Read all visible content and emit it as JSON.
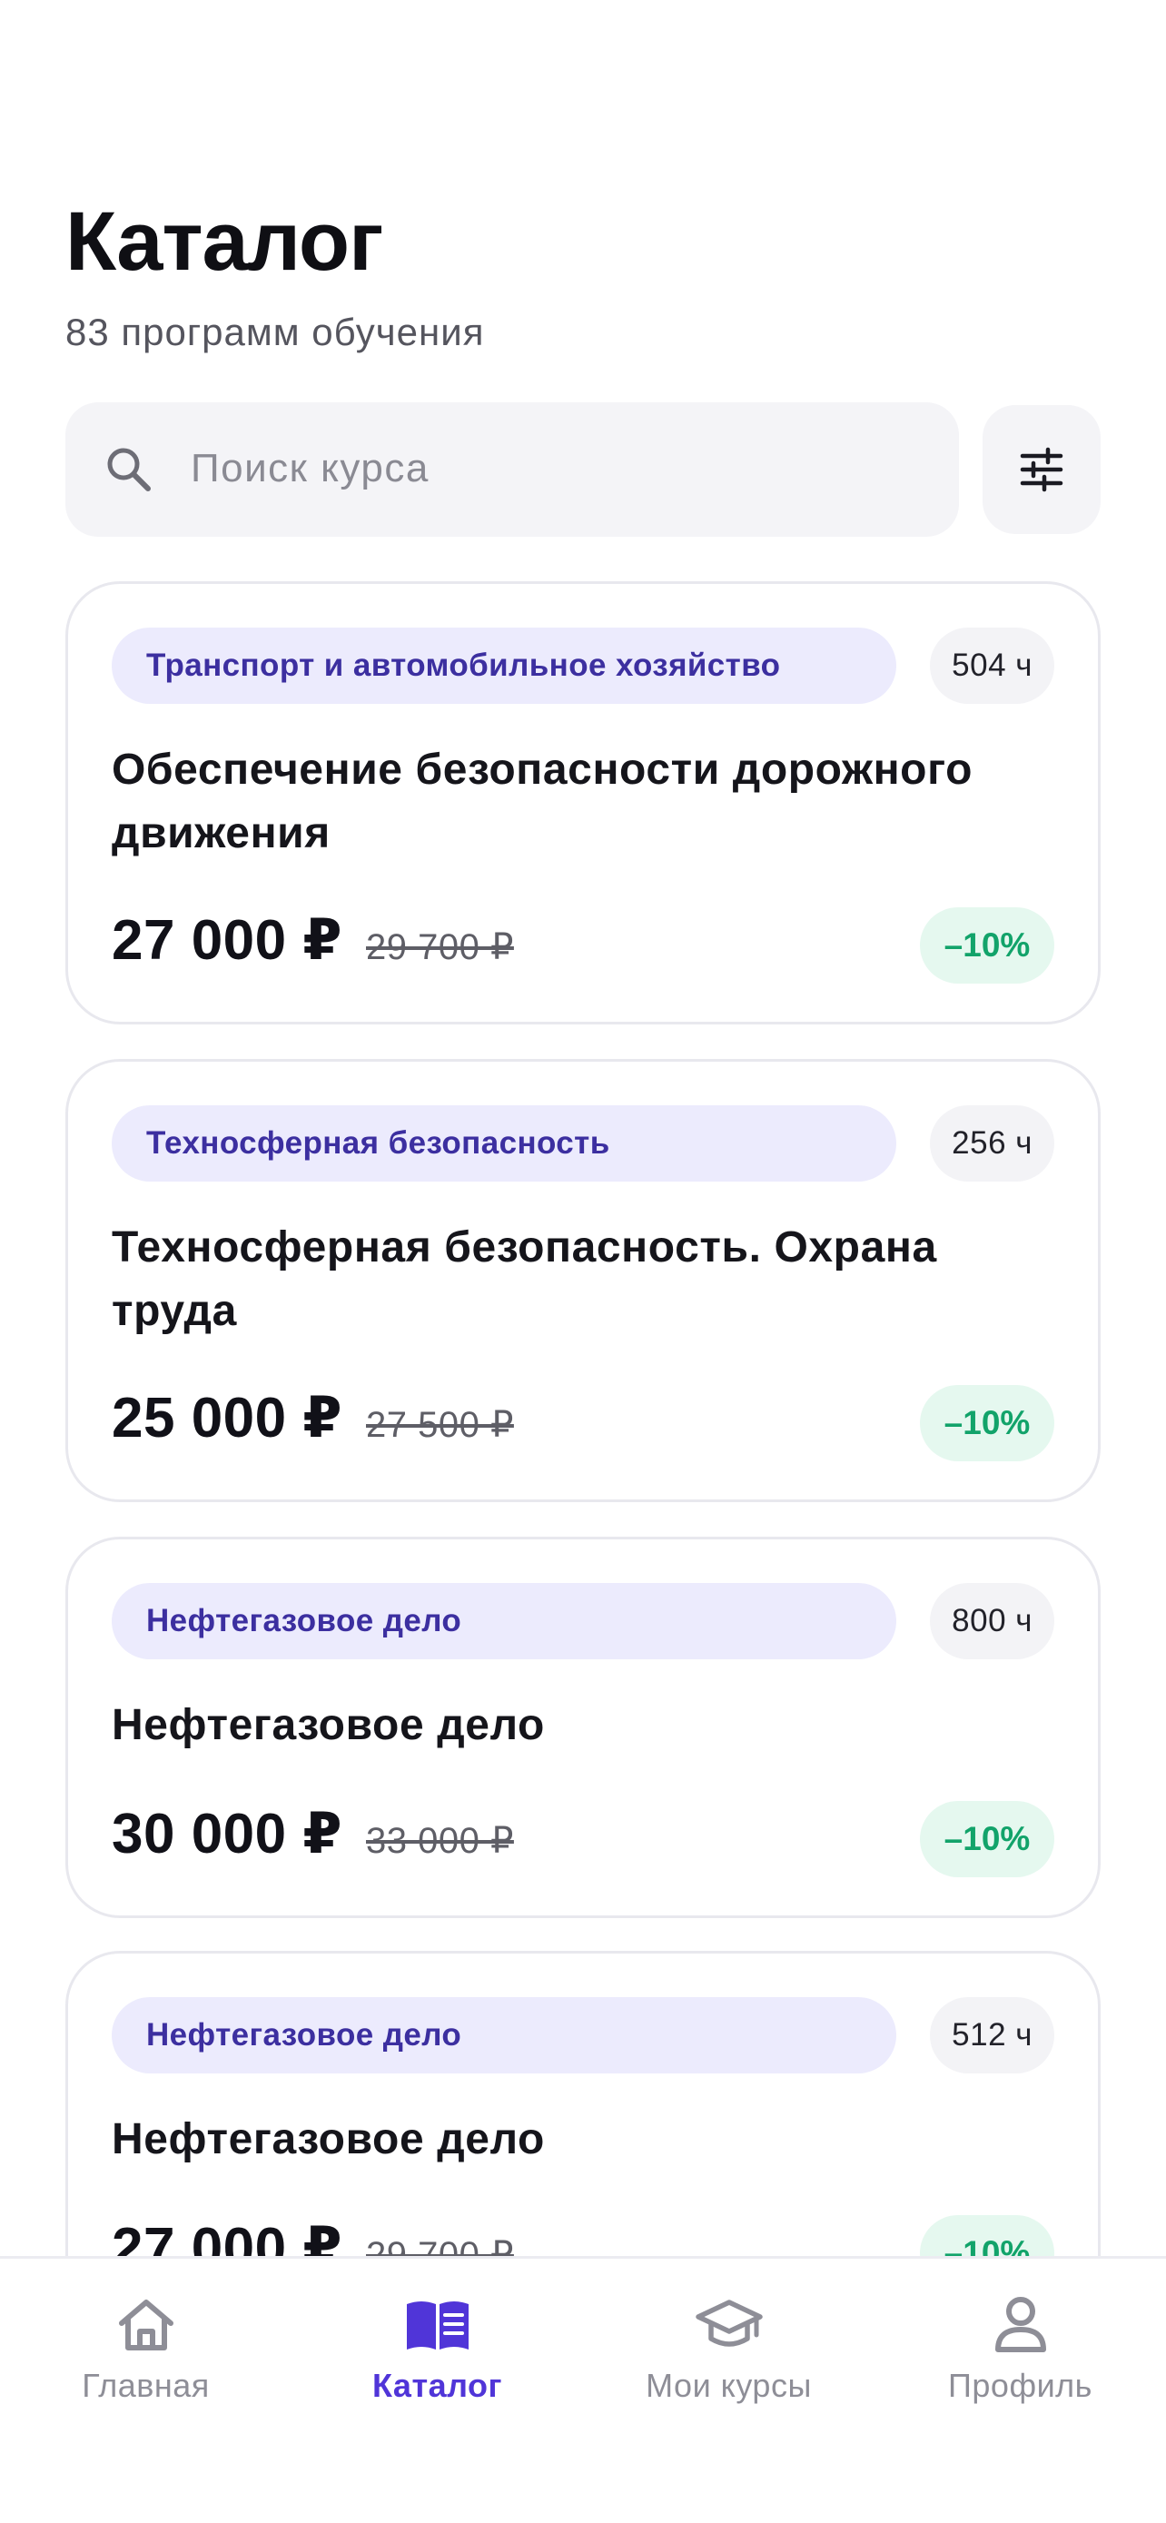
{
  "header": {
    "title": "Каталог",
    "subtitle": "83 программ обучения"
  },
  "search": {
    "placeholder": "Поиск курса",
    "icon": "search-icon"
  },
  "filter": {
    "icon": "sliders-icon"
  },
  "colors": {
    "accent": "#5035d8",
    "category_pill_bg": "#ecebfd",
    "category_text": "#3c2fa0",
    "discount_bg": "#e5f8ef",
    "discount_text": "#12a36a"
  },
  "courses": [
    {
      "category": "Транспорт и автомобильное хозяйство",
      "hours": "504 ч",
      "title": "Обеспечение безопасности дорожного движения",
      "price": "27 000 ₽",
      "old_price": "29 700 ₽",
      "discount": "–10%"
    },
    {
      "category": "Техносферная безопасность",
      "hours": "256 ч",
      "title": "Техносферная безопасность. Охрана труда",
      "price": "25 000 ₽",
      "old_price": "27 500 ₽",
      "discount": "–10%"
    },
    {
      "category": "Нефтегазовое дело",
      "hours": "800 ч",
      "title": "Нефтегазовое дело",
      "price": "30 000 ₽",
      "old_price": "33 000 ₽",
      "discount": "–10%"
    },
    {
      "category": "Нефтегазовое дело",
      "hours": "512 ч",
      "title": "Нефтегазовое дело",
      "price": "27 000 ₽",
      "old_price": "29 700 ₽",
      "discount": "–10%"
    }
  ],
  "nav": {
    "active": "Каталог",
    "items": [
      {
        "label": "Главная",
        "icon": "home-icon"
      },
      {
        "label": "Каталог",
        "icon": "book-icon"
      },
      {
        "label": "Мои курсы",
        "icon": "graduation-cap-icon"
      },
      {
        "label": "Профиль",
        "icon": "user-icon"
      }
    ]
  }
}
